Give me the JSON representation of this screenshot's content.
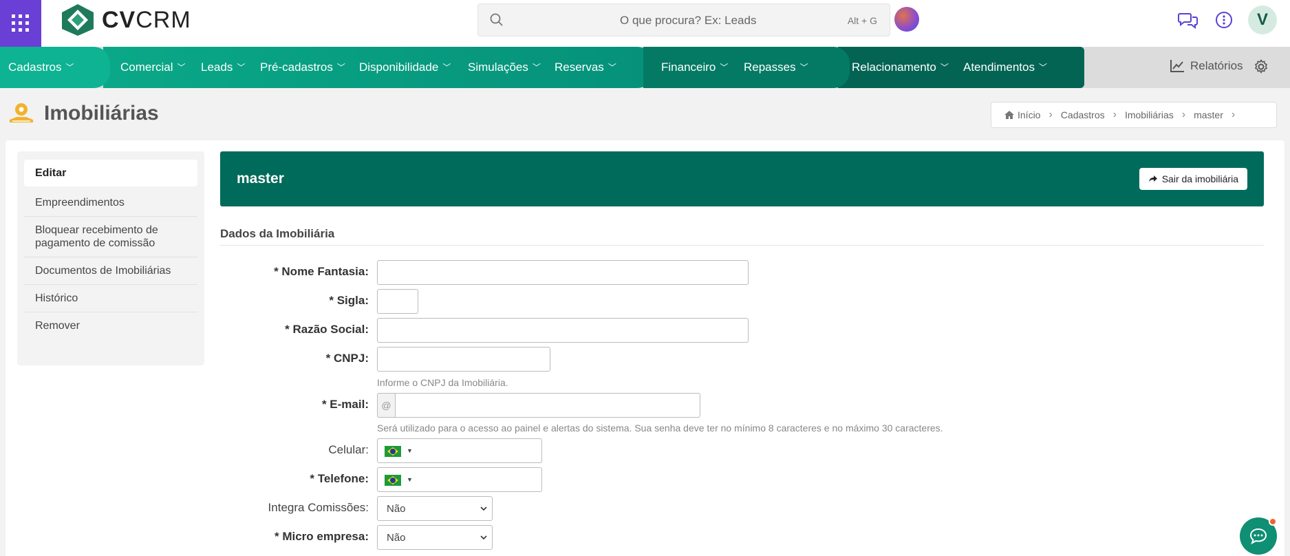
{
  "topbar": {
    "logo_text_bold": "CV",
    "logo_text_thin": "CRM",
    "search_placeholder": "O que procura? Ex: Leads",
    "search_shortcut": "Alt + G",
    "user_initial": "V",
    "icons": [
      "apps-grid-icon",
      "search-icon",
      "chat-bubbles-icon",
      "more-info-icon"
    ]
  },
  "nav": {
    "items": [
      {
        "label": "Cadastros"
      },
      {
        "label": "Comercial"
      },
      {
        "label": "Leads"
      },
      {
        "label": "Pré-cadastros"
      },
      {
        "label": "Disponibilidade"
      },
      {
        "label": "Simulações"
      },
      {
        "label": "Reservas"
      },
      {
        "label": "Financeiro"
      },
      {
        "label": "Repasses"
      },
      {
        "label": "Relacionamento"
      },
      {
        "label": "Atendimentos"
      }
    ],
    "reports_label": "Relatórios",
    "colors": {
      "seg1": "#0db392",
      "seg2": "#06917a",
      "seg3": "#047a65",
      "seg4": "#036454"
    }
  },
  "page": {
    "title": "Imobiliárias",
    "breadcrumb": [
      "Início",
      "Cadastros",
      "Imobiliárias",
      "master"
    ]
  },
  "sidebar": {
    "items": [
      {
        "label": "Editar",
        "active": true
      },
      {
        "label": "Empreendimentos"
      },
      {
        "label": "Bloquear recebimento de pagamento de comissão"
      },
      {
        "label": "Documentos de Imobiliárias"
      },
      {
        "label": "Histórico"
      },
      {
        "label": "Remover"
      }
    ]
  },
  "banner": {
    "title": "master",
    "exit_label": "Sair da imobiliária",
    "color": "#006b5a"
  },
  "form": {
    "section_title": "Dados da Imobiliária",
    "fields": {
      "nome_fantasia": {
        "label": "* Nome Fantasia:",
        "value": ""
      },
      "sigla": {
        "label": "* Sigla:",
        "value": ""
      },
      "razao_social": {
        "label": "* Razão Social:",
        "value": ""
      },
      "cnpj": {
        "label": "* CNPJ:",
        "value": "",
        "help": "Informe o CNPJ da Imobiliária."
      },
      "email": {
        "label": "* E-mail:",
        "value": "",
        "addon": "@",
        "help": "Será utilizado para o acesso ao painel e alertas do sistema. Sua senha deve ter no mínimo 8 caracteres e no máximo 30 caracteres."
      },
      "celular": {
        "label": "Celular:",
        "value": ""
      },
      "telefone": {
        "label": "* Telefone:",
        "value": ""
      },
      "integra_comissoes": {
        "label": "Integra Comissões:",
        "value": "Não"
      },
      "micro_empresa": {
        "label": "* Micro empresa:",
        "value": "Não"
      }
    }
  }
}
